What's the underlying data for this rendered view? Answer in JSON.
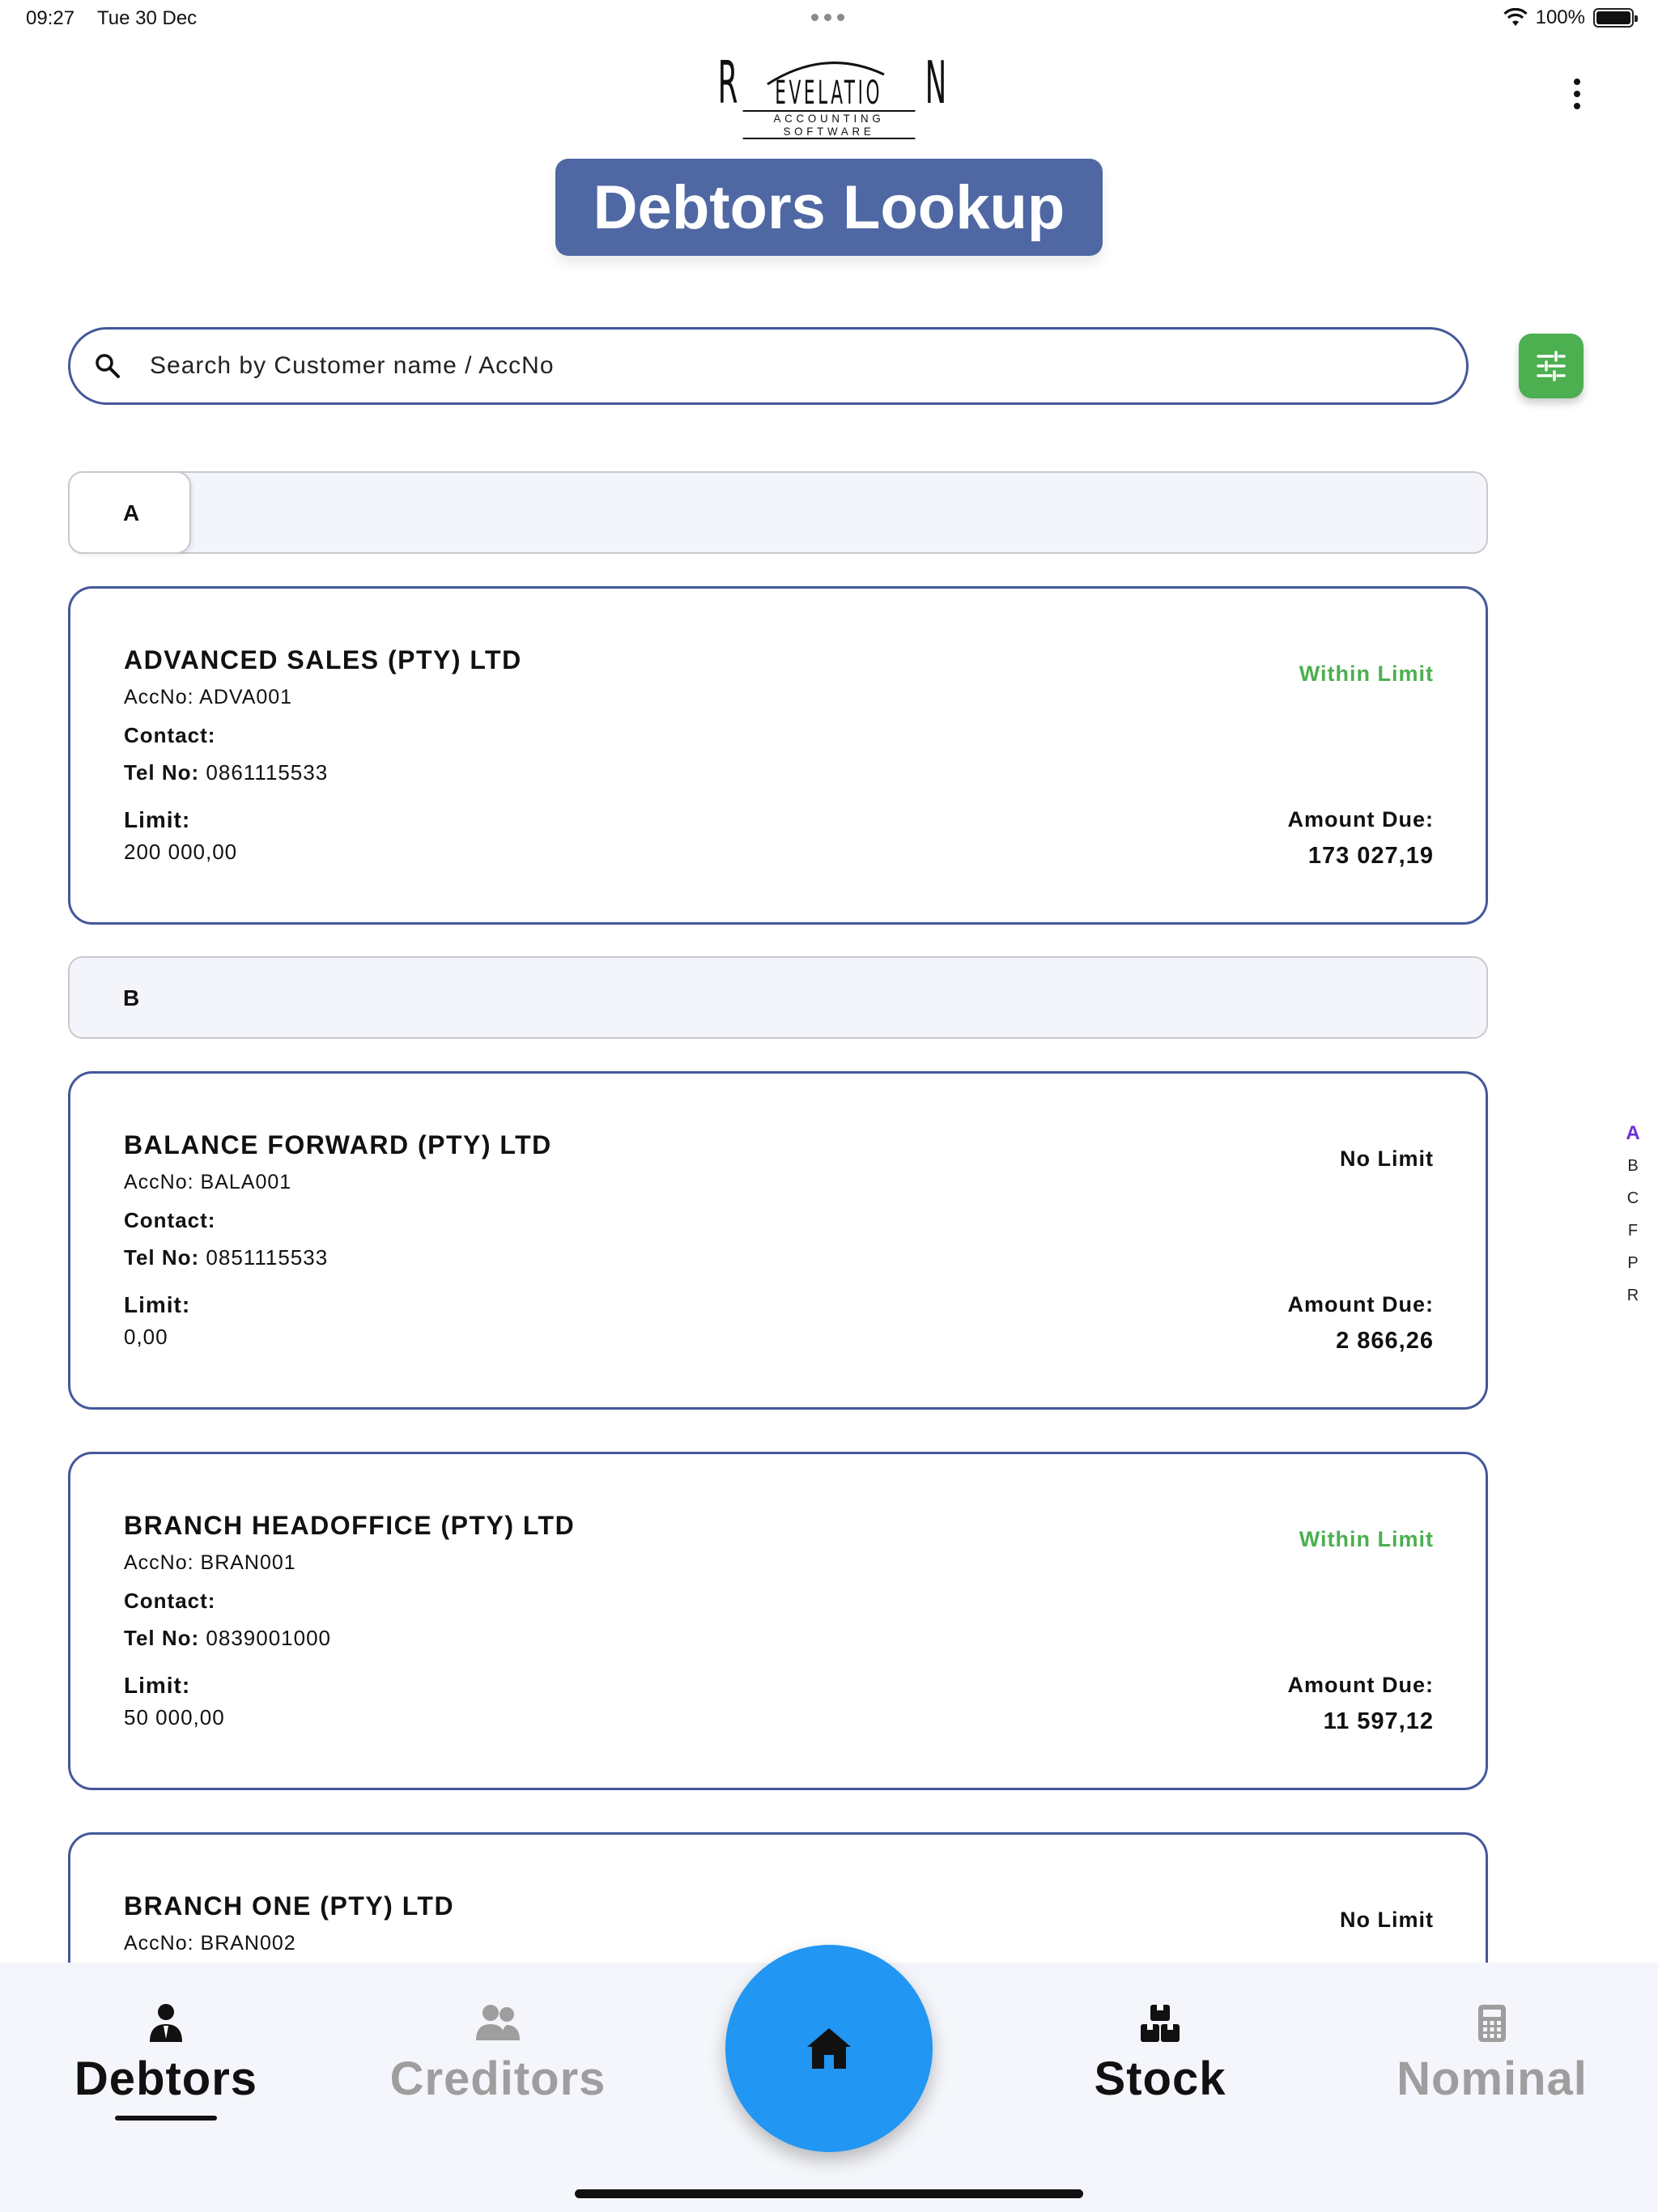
{
  "status_bar": {
    "time": "09:27",
    "date": "Tue 30 Dec",
    "battery": "100%"
  },
  "logo": {
    "first": "R",
    "middle": "EVELATIO",
    "last": "N",
    "subtitle": "ACCOUNTING SOFTWARE"
  },
  "page_title": "Debtors Lookup",
  "search": {
    "placeholder": "Search by Customer name / AccNo",
    "value": ""
  },
  "sections": [
    {
      "letter": "A"
    },
    {
      "letter": "B"
    }
  ],
  "debtors": [
    {
      "name": "ADVANCED SALES (PTY) LTD",
      "acc": "AccNo: ADVA001",
      "contact": "Contact:",
      "tel_label": "Tel No:",
      "tel": "0861115533",
      "limit_label": "Limit:",
      "limit": "200 000,00",
      "status": "Within Limit",
      "status_color": "#4caf50",
      "due_label": "Amount Due:",
      "due": "173 027,19"
    },
    {
      "name": "BALANCE FORWARD (PTY) LTD",
      "acc": "AccNo: BALA001",
      "contact": "Contact:",
      "tel_label": "Tel No:",
      "tel": "0851115533",
      "limit_label": "Limit:",
      "limit": "0,00",
      "status": "No Limit",
      "status_color": "#111111",
      "due_label": "Amount Due:",
      "due": "2 866,26"
    },
    {
      "name": "BRANCH HEADOFFICE (PTY) LTD",
      "acc": "AccNo: BRAN001",
      "contact": "Contact:",
      "tel_label": "Tel No:",
      "tel": "0839001000",
      "limit_label": "Limit:",
      "limit": "50 000,00",
      "status": "Within Limit",
      "status_color": "#4caf50",
      "due_label": "Amount Due:",
      "due": "11 597,12"
    },
    {
      "name": "BRANCH ONE (PTY) LTD",
      "acc": "AccNo: BRAN002",
      "status": "No Limit",
      "status_color": "#111111"
    }
  ],
  "alpha_index": [
    "A",
    "B",
    "C",
    "F",
    "P",
    "R"
  ],
  "alpha_active": "A",
  "nav": {
    "debtors": "Debtors",
    "creditors": "Creditors",
    "stock": "Stock",
    "nominal": "Nominal"
  },
  "colors": {
    "accent": "#4f68a3",
    "filter_button": "#4caf50",
    "home_button": "#2196f3",
    "active_index": "#6a2fd6",
    "inactive_nav": "#9e9e9e"
  },
  "icons": {
    "search": "search-icon",
    "filter": "tune-icon",
    "menu": "more-vert-icon",
    "home": "home-icon",
    "debtors": "person-icon",
    "creditors": "people-icon",
    "stock": "boxes-icon",
    "nominal": "calculator-icon"
  }
}
